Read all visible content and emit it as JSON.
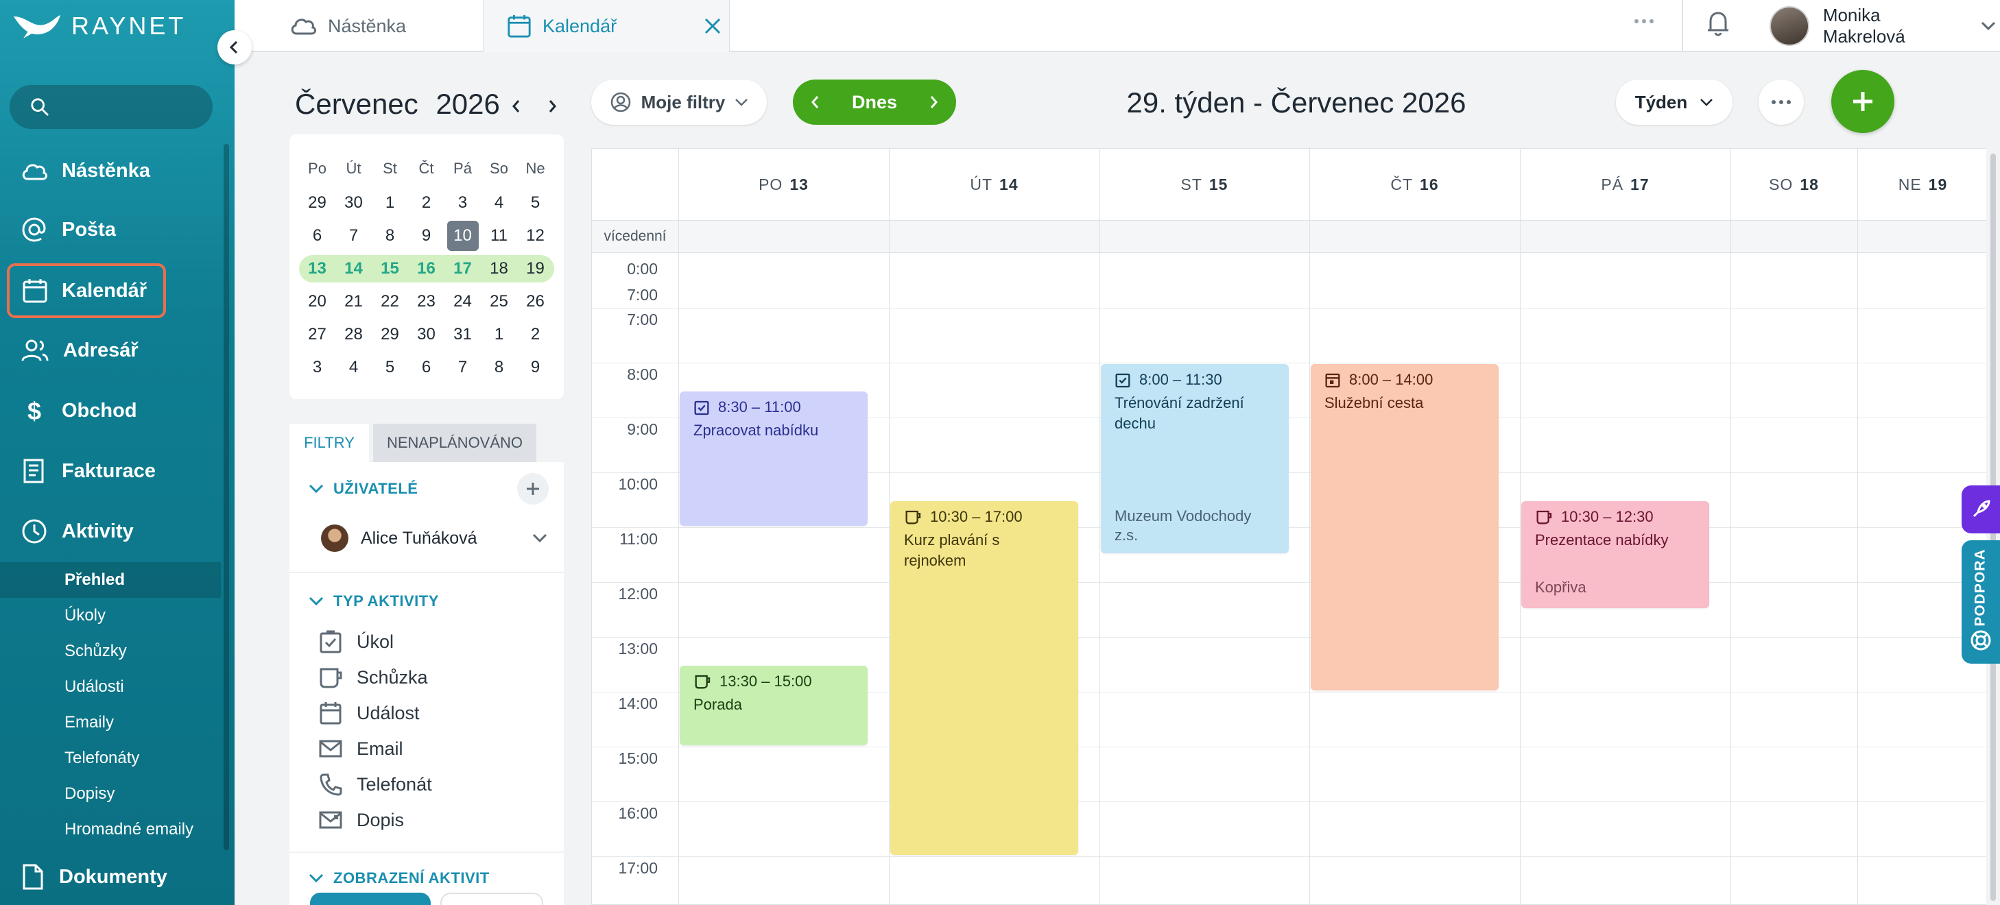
{
  "brand": {
    "name": "RAYNET"
  },
  "search": {
    "placeholder": ""
  },
  "nav": {
    "items": [
      {
        "label": "Nástěnka",
        "icon": "cloud-icon"
      },
      {
        "label": "Pošta",
        "icon": "at-icon"
      },
      {
        "label": "Kalendář",
        "icon": "calendar-icon"
      },
      {
        "label": "Adresář",
        "icon": "contacts-icon"
      },
      {
        "label": "Obchod",
        "icon": "dollar-icon"
      },
      {
        "label": "Fakturace",
        "icon": "invoice-icon"
      },
      {
        "label": "Aktivity",
        "icon": "clock-icon"
      }
    ],
    "sub_items": [
      "Přehled",
      "Úkoly",
      "Schůzky",
      "Události",
      "Emaily",
      "Telefonáty",
      "Dopisy",
      "Hromadné emaily"
    ],
    "bottom_item": {
      "label": "Dokumenty",
      "icon": "document-icon"
    }
  },
  "tabs": [
    {
      "label": "Nástěnka",
      "icon": "cloud-icon"
    },
    {
      "label": "Kalendář",
      "icon": "calendar-icon"
    }
  ],
  "user": {
    "name": "Monika Makrelová"
  },
  "mini_calendar": {
    "month": "Červenec",
    "year": "2026",
    "weekdays": [
      "Po",
      "Út",
      "St",
      "Čt",
      "Pá",
      "So",
      "Ne"
    ],
    "weeks": [
      [
        "29",
        "30",
        "1",
        "2",
        "3",
        "4",
        "5"
      ],
      [
        "6",
        "7",
        "8",
        "9",
        "10",
        "11",
        "12"
      ],
      [
        "13",
        "14",
        "15",
        "16",
        "17",
        "18",
        "19"
      ],
      [
        "20",
        "21",
        "22",
        "23",
        "24",
        "25",
        "26"
      ],
      [
        "27",
        "28",
        "29",
        "30",
        "31",
        "1",
        "2"
      ],
      [
        "3",
        "4",
        "5",
        "6",
        "7",
        "8",
        "9"
      ]
    ],
    "today": "10"
  },
  "filters": {
    "tab_filters": "FILTRY",
    "tab_unplanned": "NENAPLÁNOVÁNO",
    "users_heading": "UŽIVATELÉ",
    "selected_user": "Alice Tuňáková",
    "activity_type_heading": "TYP AKTIVITY",
    "activity_types": [
      {
        "label": "Úkol",
        "icon": "task-icon"
      },
      {
        "label": "Schůzka",
        "icon": "meeting-icon"
      },
      {
        "label": "Událost",
        "icon": "event-icon"
      },
      {
        "label": "Email",
        "icon": "email-icon"
      },
      {
        "label": "Telefonát",
        "icon": "phone-icon"
      },
      {
        "label": "Dopis",
        "icon": "letter-icon"
      }
    ],
    "display_heading": "ZOBRAZENÍ AKTIVIT"
  },
  "toolbar": {
    "my_filters": "Moje filtry",
    "today": "Dnes",
    "week_title": "29. týden - Červenec 2026",
    "view": "Týden"
  },
  "calendar": {
    "days": [
      {
        "name": "PO",
        "num": "13"
      },
      {
        "name": "ÚT",
        "num": "14"
      },
      {
        "name": "ST",
        "num": "15"
      },
      {
        "name": "ČT",
        "num": "16"
      },
      {
        "name": "PÁ",
        "num": "17"
      },
      {
        "name": "SO",
        "num": "18"
      },
      {
        "name": "NE",
        "num": "19"
      }
    ],
    "multiday_label": "vícedenní",
    "time_labels": [
      "0:00",
      "7:00",
      "7:00",
      "8:00",
      "9:00",
      "10:00",
      "11:00",
      "12:00",
      "13:00",
      "14:00",
      "15:00",
      "16:00",
      "17:00"
    ],
    "events": [
      {
        "time": "8:30 – 11:00",
        "title": "Zpracovat nabídku",
        "location": "",
        "type": "task",
        "color": "#cfd2fb",
        "text_color": "#2a2f8f"
      },
      {
        "time": "13:30 – 15:00",
        "title": "Porada",
        "location": "",
        "type": "meeting",
        "color": "#c6efb0",
        "text_color": "#1f3d12"
      },
      {
        "time": "10:30 – 17:00",
        "title": "Kurz plavání s rejnokem",
        "location": "",
        "type": "meeting",
        "color": "#f3e58a",
        "text_color": "#3d350a"
      },
      {
        "time": "8:00 – 11:30",
        "title": "Trénování zadržení dechu",
        "location": "Muzeum Vodochody z.s.",
        "type": "task",
        "color": "#c2e5f6",
        "text_color": "#123e55"
      },
      {
        "time": "8:00 – 14:00",
        "title": "Služební cesta",
        "location": "",
        "type": "event",
        "color": "#fbc8b2",
        "text_color": "#5a2410"
      },
      {
        "time": "10:30 – 12:30",
        "title": "Prezentace nabídky",
        "location": "Kopřiva",
        "type": "meeting",
        "color": "#f9bcc9",
        "text_color": "#6a1530"
      }
    ]
  },
  "support": {
    "label": "PODPORA"
  },
  "colors": {
    "brand": "#128aa0",
    "accent_green": "#43a61b",
    "highlight": "#e8704e"
  }
}
